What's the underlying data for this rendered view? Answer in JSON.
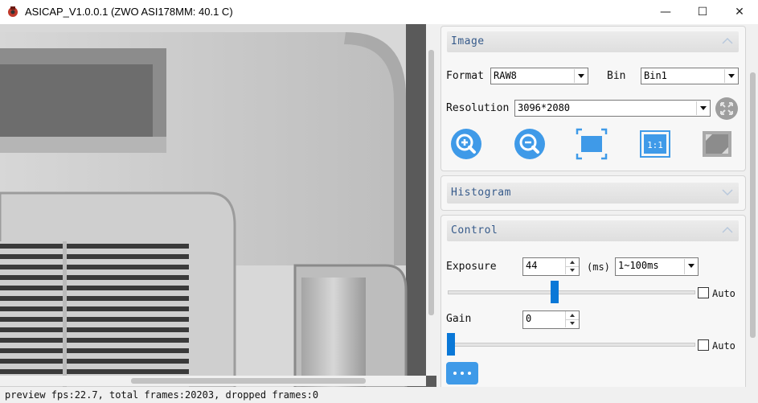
{
  "window": {
    "title": "ASICAP_V1.0.0.1 (ZWO ASI178MM: 40.1 C)",
    "minimize_glyph": "—",
    "maximize_glyph": "☐",
    "close_glyph": "✕"
  },
  "status": {
    "text": "preview fps:22.7, total frames:20203, dropped frames:0"
  },
  "image_panel": {
    "title": "Image",
    "format_label": "Format",
    "format_value": "RAW8",
    "bin_label": "Bin",
    "bin_value": "Bin1",
    "resolution_label": "Resolution",
    "resolution_value": "3096*2080",
    "icons": [
      "zoom-in-icon",
      "zoom-out-icon",
      "fit-to-window-icon",
      "actual-size-icon",
      "fullscreen-icon",
      "roi-center-icon"
    ]
  },
  "histogram_panel": {
    "title": "Histogram"
  },
  "control_panel": {
    "title": "Control",
    "exposure": {
      "label": "Exposure",
      "value": "44",
      "unit": "(ms)",
      "range_value": "1~100ms",
      "auto_label": "Auto",
      "slider_fraction": 0.43
    },
    "gain": {
      "label": "Gain",
      "value": "0",
      "auto_label": "Auto",
      "slider_fraction": 0.0
    }
  },
  "colors": {
    "accent": "#0a78d7",
    "button_blue": "#3f9ae8",
    "group_title": "#365a8a"
  }
}
